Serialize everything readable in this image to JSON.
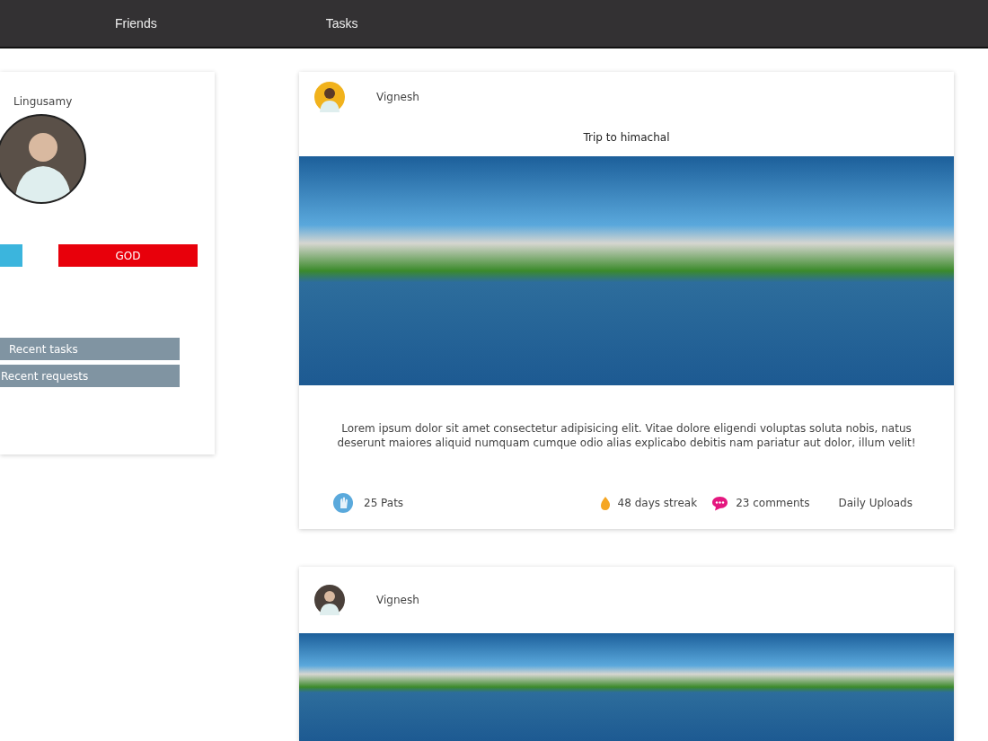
{
  "nav": {
    "items": [
      {
        "label": "Friends"
      },
      {
        "label": "Tasks"
      }
    ]
  },
  "profile": {
    "name": "Lingusamy",
    "badges": [
      {
        "color": "#3bb5dd"
      },
      {
        "label": "GOD",
        "color": "#e8000b"
      }
    ],
    "links": [
      "Recent tasks",
      "Recent requests"
    ]
  },
  "posts": [
    {
      "author": "Vignesh",
      "title": "Trip to himachal",
      "body": "Lorem ipsum dolor sit amet consectetur adipisicing elit. Vitae dolore eligendi voluptas soluta nobis, natus deserunt maiores aliquid numquam cumque odio alias explicabo debitis nam pariatur aut dolor, illum velit!",
      "pats": "25 Pats",
      "streak": "48 days streak",
      "comments": "23 comments",
      "category": "Daily Uploads"
    },
    {
      "author": "Vignesh"
    }
  ]
}
